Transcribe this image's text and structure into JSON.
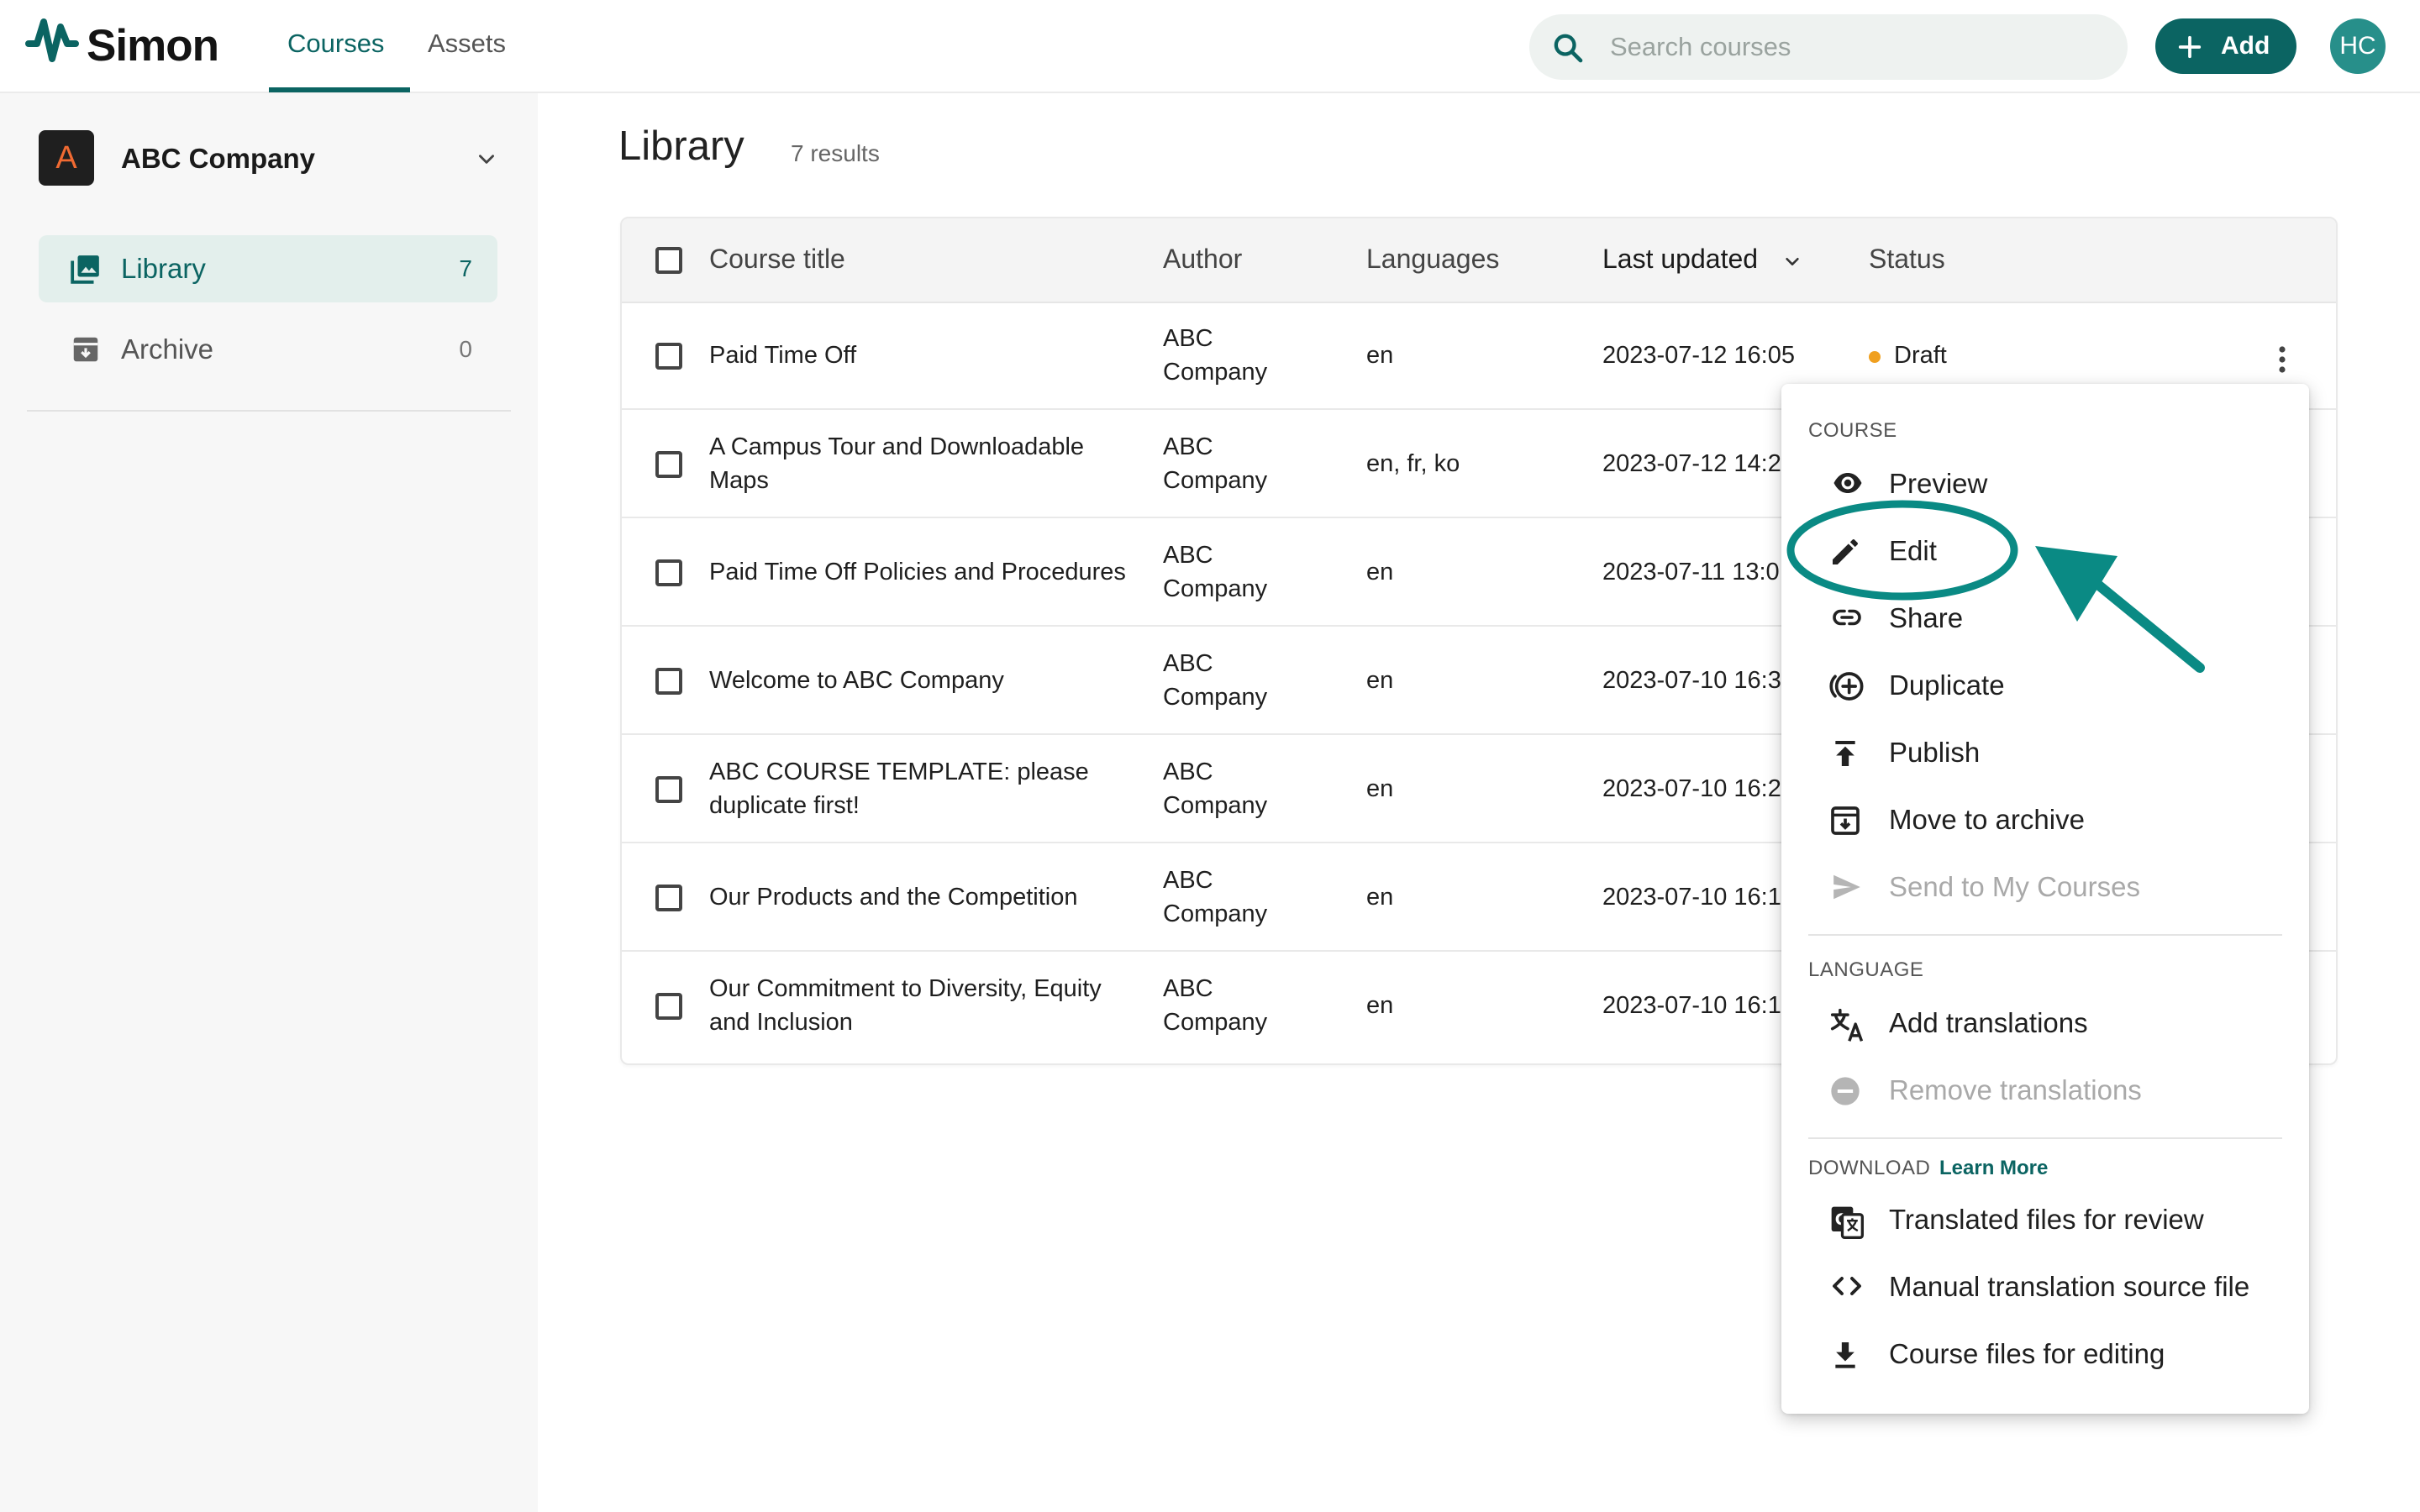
{
  "app": {
    "name": "Simon",
    "nav_tabs": [
      {
        "label": "Courses",
        "active": true
      },
      {
        "label": "Assets",
        "active": false
      }
    ],
    "search_placeholder": "Search courses",
    "add_label": "Add",
    "user_initials": "HC",
    "brand_color": "#0b6462"
  },
  "sidebar": {
    "org_initial": "A",
    "org_name": "ABC Company",
    "items": [
      {
        "label": "Library",
        "count": "7",
        "icon": "library-icon",
        "active": true
      },
      {
        "label": "Archive",
        "count": "0",
        "icon": "archive-icon",
        "active": false
      }
    ]
  },
  "main": {
    "title": "Library",
    "result_count": "7 results",
    "columns": [
      "Course title",
      "Author",
      "Languages",
      "Last updated",
      "Status"
    ],
    "sort_column": "Last updated",
    "rows": [
      {
        "title": "Paid Time Off",
        "author": "ABC Company",
        "languages": "en",
        "updated": "2023-07-12 16:05",
        "status": "Draft"
      },
      {
        "title": "A Campus Tour and Downloadable Maps",
        "author": "ABC Company",
        "languages": "en, fr, ko",
        "updated": "2023-07-12 14:2",
        "status": ""
      },
      {
        "title": "Paid Time Off Policies and Procedures",
        "author": "ABC Company",
        "languages": "en",
        "updated": "2023-07-11 13:0",
        "status": ""
      },
      {
        "title": "Welcome to ABC Company",
        "author": "ABC Company",
        "languages": "en",
        "updated": "2023-07-10 16:3",
        "status": ""
      },
      {
        "title": "ABC COURSE TEMPLATE: please duplicate first!",
        "author": "ABC Company",
        "languages": "en",
        "updated": "2023-07-10 16:2",
        "status": ""
      },
      {
        "title": "Our Products and the Competition",
        "author": "ABC Company",
        "languages": "en",
        "updated": "2023-07-10 16:1",
        "status": ""
      },
      {
        "title": "Our Commitment to Diversity, Equity and Inclusion",
        "author": "ABC Company",
        "languages": "en",
        "updated": "2023-07-10 16:1",
        "status": ""
      }
    ]
  },
  "menu": {
    "sections": {
      "course": "COURSE",
      "language": "LANGUAGE",
      "download": "DOWNLOAD",
      "download_link": "Learn More"
    },
    "course_items": [
      {
        "label": "Preview",
        "icon": "eye-icon",
        "disabled": false
      },
      {
        "label": "Edit",
        "icon": "pencil-icon",
        "disabled": false
      },
      {
        "label": "Share",
        "icon": "link-icon",
        "disabled": false
      },
      {
        "label": "Duplicate",
        "icon": "add-circle-icon",
        "disabled": false
      },
      {
        "label": "Publish",
        "icon": "publish-icon",
        "disabled": false
      },
      {
        "label": "Move to archive",
        "icon": "archive-icon",
        "disabled": false
      },
      {
        "label": "Send to My Courses",
        "icon": "send-icon",
        "disabled": true
      }
    ],
    "language_items": [
      {
        "label": "Add translations",
        "icon": "translate-icon",
        "disabled": false
      },
      {
        "label": "Remove translations",
        "icon": "remove-circle-icon",
        "disabled": true
      }
    ],
    "download_items": [
      {
        "label": "Translated files for review",
        "icon": "google-translate-icon",
        "disabled": false
      },
      {
        "label": "Manual translation source file",
        "icon": "code-icon",
        "disabled": false
      },
      {
        "label": "Course files for editing",
        "icon": "download-icon",
        "disabled": false
      }
    ]
  },
  "annotation": {
    "highlighted_item": "Edit",
    "color": "#0a8a84"
  }
}
